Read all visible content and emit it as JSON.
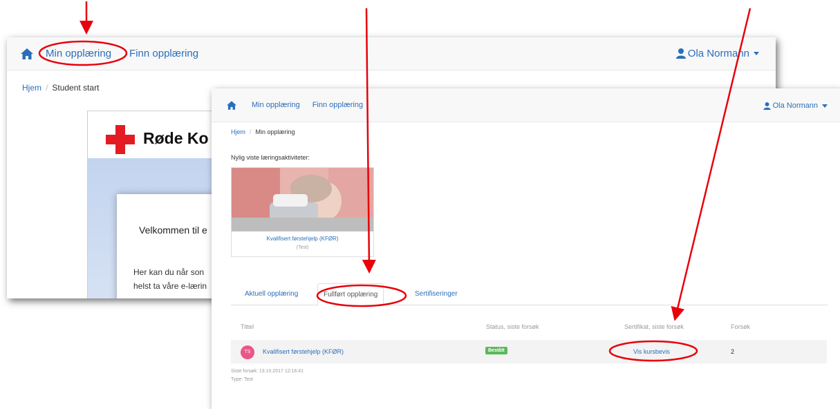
{
  "back_window": {
    "nav": {
      "min_opplaering": "Min opplæring",
      "finn_opplaering": "Finn opplæring",
      "user": "Ola Normann"
    },
    "breadcrumb": {
      "home": "Hjem",
      "current": "Student start"
    },
    "rk": {
      "logo_text": "Røde Ko",
      "welcome": "Velkommen til  e",
      "text1": "Her kan du når son",
      "text2": "helst ta våre e-lærin"
    }
  },
  "front_window": {
    "nav": {
      "min_opplaering": "Min opplæring",
      "finn_opplaering": "Finn opplæring",
      "user": "Ola Normann"
    },
    "breadcrumb": {
      "home": "Hjem",
      "current": "Min opplæring"
    },
    "recent_label": "Nylig viste læringsaktiviteter:",
    "recent_course": {
      "title": "Kvalifisert førstehjelp (KFØR)",
      "type": "(Test)"
    },
    "tabs": [
      "Aktuell opplæring",
      "Fullført opplæring",
      "Sertifiseringer"
    ],
    "table": {
      "headers": {
        "title": "Tittel",
        "status": "Status, siste forsøk",
        "certificate": "Sertifikat, siste forsøk",
        "attempts": "Forsøk"
      },
      "row": {
        "initials": "TS",
        "title": "Kvalifisert førstehjelp (KFØR)",
        "status": "Bestått",
        "certificate": "Vis kursbevis",
        "attempts": "2",
        "last_attempt": "Siste forsøk: 13.10.2017 12:16:41",
        "type": "Type: Test"
      }
    }
  },
  "colors": {
    "link": "#2a6ebb",
    "annotation_red": "#e8000b",
    "success": "#5cb85c",
    "avatar": "#e8578a"
  }
}
